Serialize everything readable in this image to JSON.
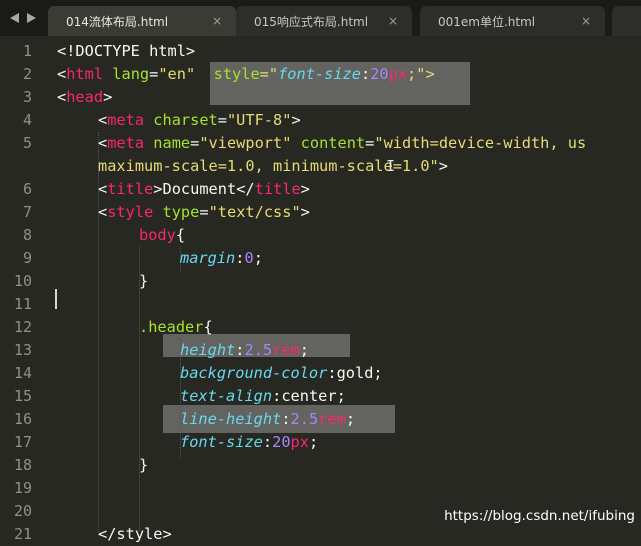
{
  "nav": {
    "back_icon": "triangle-left",
    "forward_icon": "triangle-right"
  },
  "tabs": [
    {
      "label": "014流体布局.html",
      "close": "×",
      "active": true
    },
    {
      "label": "015响应式布局.html",
      "close": "×",
      "active": false
    },
    {
      "label": "001em单位.html",
      "close": "×",
      "active": false
    }
  ],
  "line_numbers": [
    "1",
    "2",
    "3",
    "4",
    "5",
    "6",
    "7",
    "8",
    "9",
    "10",
    "11",
    "12",
    "13",
    "14",
    "15",
    "16",
    "17",
    "18",
    "19",
    "20",
    "21"
  ],
  "code": {
    "l1_doctype": "<!DOCTYPE html>",
    "l2_open": "<",
    "l2_tag": "html",
    "l2_attr": "lang",
    "l2_eq": "=",
    "l2_val": "\"en\"",
    "l2_style_attr": "style",
    "l2_style_eq": "=\"",
    "l2_prop": "font-size",
    "l2_colon": ":",
    "l2_num": "20",
    "l2_unit": "px",
    "l2_end": ";\">",
    "l3_open": "<",
    "l3_tag": "head",
    "l3_close": ">",
    "l4_open": "<",
    "l4_tag": "meta",
    "l4_attr": "charset",
    "l4_eq": "=",
    "l4_val": "\"UTF-8\"",
    "l4_close": ">",
    "l5_open": "<",
    "l5_tag": "meta",
    "l5_attr1": "name",
    "l5_eq1": "=",
    "l5_val1": "\"viewport\"",
    "l5_attr2": "content",
    "l5_eq2": "=",
    "l5_val2": "\"width=device-width, us",
    "l5b_text": "maximum-scale=1.0, minimum-scale=1.0\"",
    "l5b_close": ">",
    "l6_open": "<",
    "l6_tag": "title",
    "l6_close1": ">",
    "l6_text": "Document",
    "l6_end_open": "</",
    "l6_end_tag": "title",
    "l6_close2": ">",
    "l7_open": "<",
    "l7_tag": "style",
    "l7_attr": "type",
    "l7_eq": "=",
    "l7_val": "\"text/css\"",
    "l7_close": ">",
    "l8_sel": "body",
    "l8_brace": "{",
    "l9_prop": "margin",
    "l9_colon": ":",
    "l9_num": "0",
    "l9_semi": ";",
    "l10_brace": "}",
    "l12_sel": ".header",
    "l12_brace": "{",
    "l13_prop": "height",
    "l13_colon": ":",
    "l13_num": "2.5",
    "l13_unit": "rem",
    "l13_semi": ";",
    "l14_prop": "background-color",
    "l14_colon": ":",
    "l14_val": "gold",
    "l14_semi": ";",
    "l15_prop": "text-align",
    "l15_colon": ":",
    "l15_val": "center",
    "l15_semi": ";",
    "l16_prop": "line-height",
    "l16_colon": ":",
    "l16_num": "2.5",
    "l16_unit": "rem",
    "l16_semi": ";",
    "l17_prop": "font-size",
    "l17_colon": ":",
    "l17_num": "20",
    "l17_unit": "px",
    "l17_semi": ";",
    "l18_brace": "}",
    "l21_text": "</style>"
  },
  "watermark": "https://blog.csdn.net/ifubing",
  "colors": {
    "background": "#272822",
    "tag": "#f92672",
    "attribute": "#a6e22e",
    "string": "#e6db74",
    "number": "#ae81ff",
    "property": "#66d9ef",
    "text": "#f8f8f2"
  }
}
